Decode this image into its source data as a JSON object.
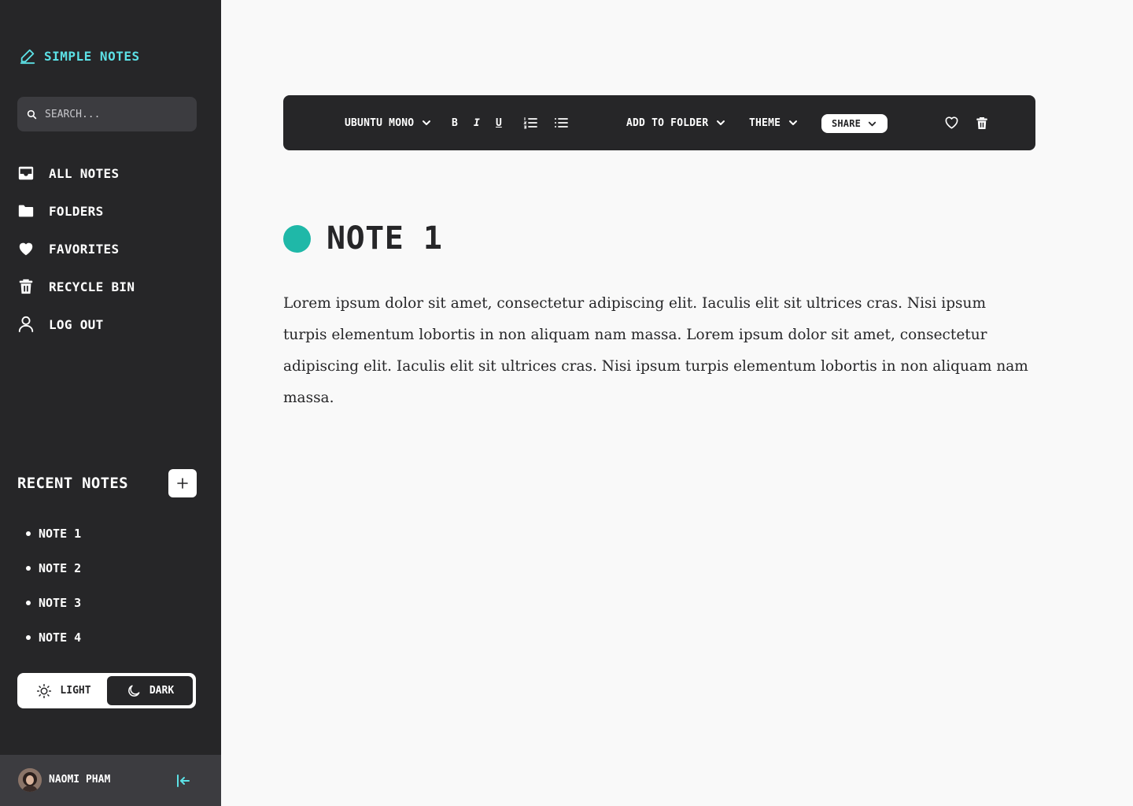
{
  "app": {
    "name": "SIMPLE NOTES",
    "accent": "#5ce1e6",
    "sidebar_bg": "#262628"
  },
  "search": {
    "placeholder": "SEARCH..."
  },
  "nav": [
    {
      "label": "ALL NOTES",
      "icon": "inbox-icon"
    },
    {
      "label": "FOLDERS",
      "icon": "folder-icon"
    },
    {
      "label": "FAVORITES",
      "icon": "heart-icon"
    },
    {
      "label": "RECYCLE BIN",
      "icon": "trash-icon"
    },
    {
      "label": "LOG OUT",
      "icon": "user-icon"
    }
  ],
  "recent": {
    "title": "RECENT NOTES",
    "items": [
      "NOTE 1",
      "NOTE 2",
      "NOTE 3",
      "NOTE 4"
    ]
  },
  "theme": {
    "light_label": "LIGHT",
    "dark_label": "DARK",
    "selected": "DARK"
  },
  "user": {
    "name": "NAOMI PHAM"
  },
  "toolbar": {
    "font": "UBUNTU MONO",
    "bold": "B",
    "italic": "I",
    "underline": "U",
    "add_to_folder": "ADD TO FOLDER",
    "theme": "THEME",
    "share": "SHARE"
  },
  "note": {
    "title": "NOTE 1",
    "color": "#1fb8a8",
    "body": "Lorem ipsum dolor sit amet, consectetur adipiscing elit. Iaculis elit sit ultrices cras. Nisi ipsum turpis elementum lobortis in non aliquam nam massa. Lorem ipsum dolor sit amet, consectetur adipiscing elit. Iaculis elit sit ultrices cras. Nisi ipsum turpis elementum lobortis in non aliquam nam massa."
  }
}
